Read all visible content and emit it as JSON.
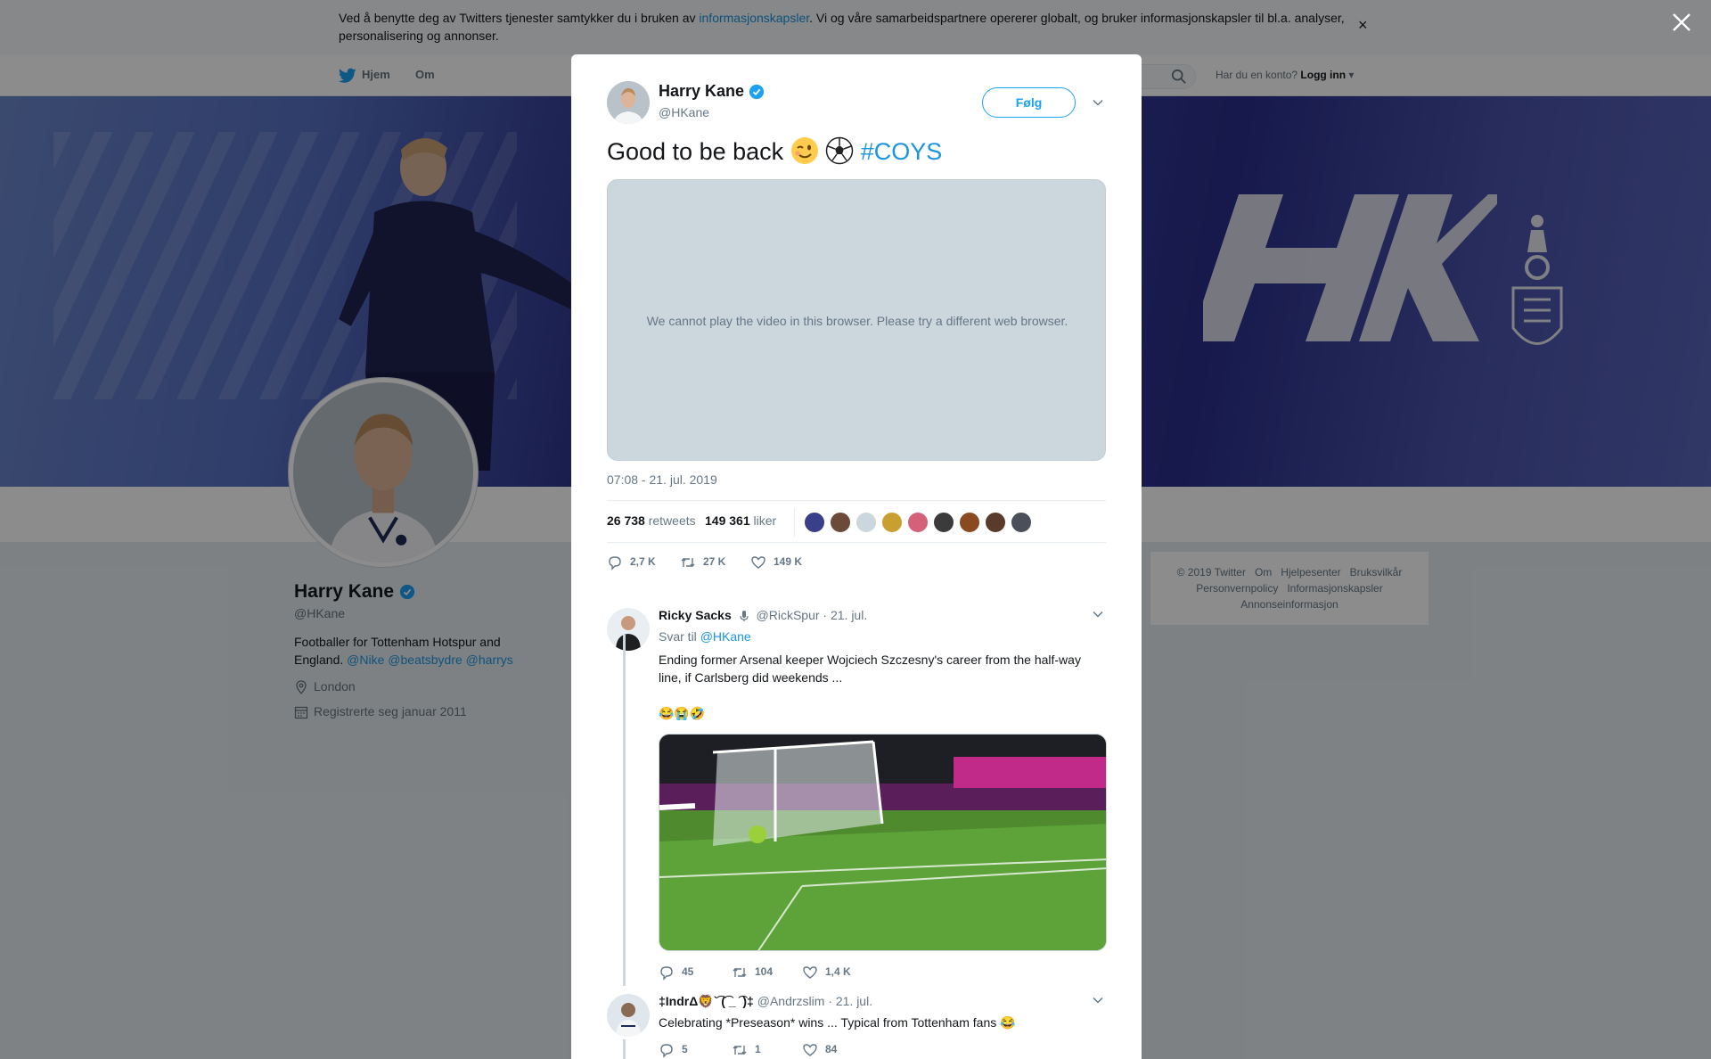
{
  "cookie_bar": {
    "text_before": "Ved å benytte deg av Twitters tjenester samtykker du i bruken av ",
    "link": "informasjonskapsler",
    "text_after": ". Vi og våre samarbeidspartnere opererer globalt, og bruker informasjonskapsler til bl.a. analyser, personalisering og annonser.",
    "close": "×"
  },
  "nav": {
    "home": "Hjem",
    "about": "Om",
    "account_prompt": "Har du en konto?",
    "login": "Logg inn"
  },
  "profile": {
    "name": "Harry Kane",
    "handle": "@HKane",
    "bio": "Footballer for Tottenham Hotspur and England.",
    "bio_links": [
      "@Nike",
      "@beatsbydre",
      "@harrys"
    ],
    "location": "London",
    "joined": "Registrerte seg januar 2011"
  },
  "banner": {
    "logo_text": "HK"
  },
  "footer": {
    "links_row1": [
      "© 2019 Twitter",
      "Om",
      "Hjelpesenter",
      "Bruksvilkår"
    ],
    "links_row2": [
      "Personvernpolicy",
      "Informasjonskapsler"
    ],
    "links_row3": [
      "Annonseinformasjon"
    ]
  },
  "tweet": {
    "author_name": "Harry Kane",
    "author_handle": "@HKane",
    "follow_label": "Følg",
    "text": "Good to be back",
    "emojis": [
      "wink",
      "⚽"
    ],
    "hashtag": "#COYS",
    "video_message": "We cannot play the video in this browser. Please try a different web browser.",
    "timestamp": "07:08 - 21. jul. 2019",
    "retweets_count": "26 738",
    "retweets_label": "retweets",
    "likes_count": "149 361",
    "likes_label": "liker",
    "replies_short": "2,7 K",
    "retweets_short": "27 K",
    "likes_short": "149 K"
  },
  "replies": [
    {
      "name": "Ricky Sacks",
      "handle": "@RickSpur",
      "date": "· 21. jul.",
      "reply_to_label": "Svar til",
      "reply_to_handle": "@HKane",
      "text": "Ending former Arsenal keeper Wojciech Szczesny's career from the half-way line, if Carlsberg did weekends ...",
      "emoji_line": "😂😭🤣",
      "replies": "45",
      "retweets": "104",
      "likes": "1,4 K"
    },
    {
      "name": "‡IndrΔ🦁`͡ (͡ _ ͡ )‡",
      "handle": "@Andrzslim",
      "date": "· 21. jul.",
      "text": "Celebrating *Preseason* wins ... Typical from Tottenham fans 😂",
      "replies": "5",
      "retweets": "1",
      "likes": "84"
    }
  ],
  "colors": {
    "accent": "#1da1f2",
    "link": "#1b95e0",
    "muted": "#657786",
    "overlay": "rgba(0,0,0,0.45)"
  }
}
